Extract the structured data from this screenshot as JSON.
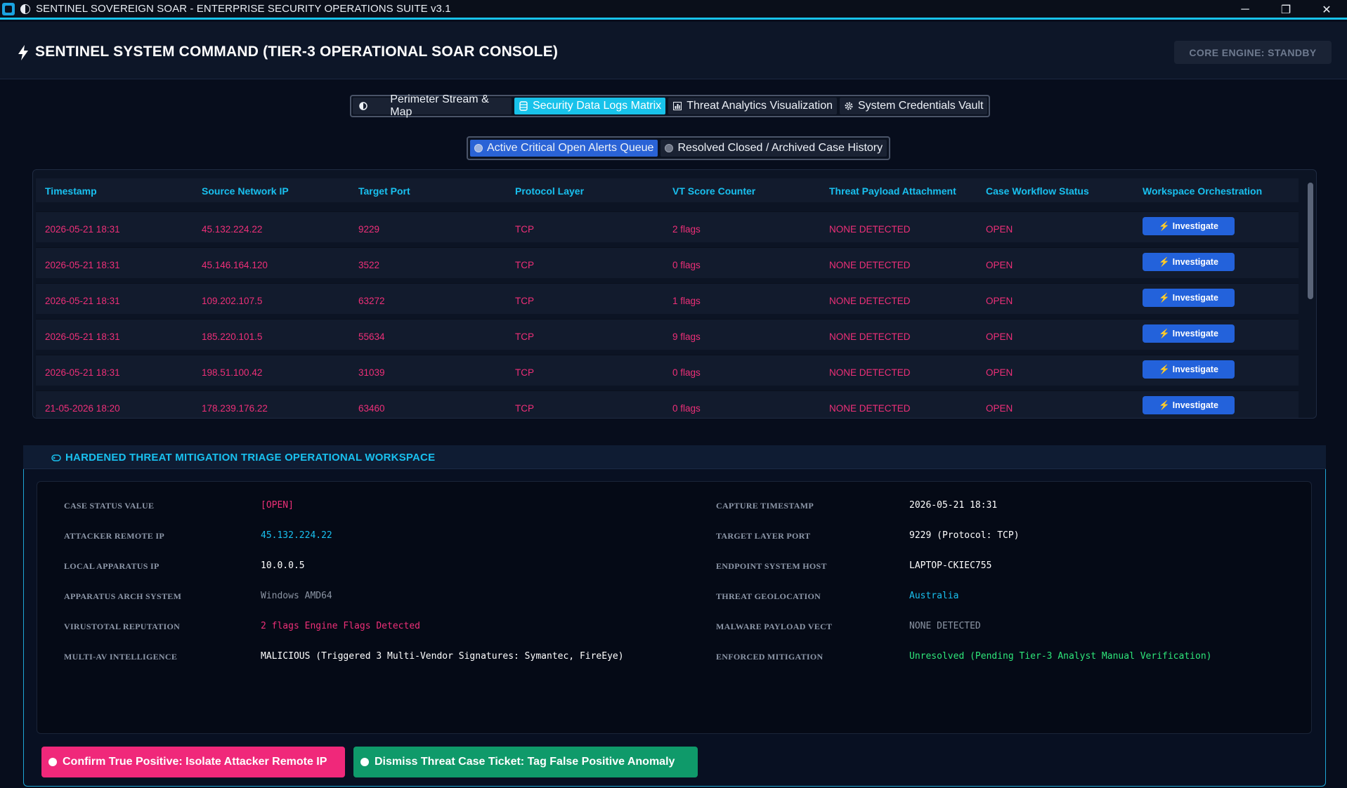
{
  "window": {
    "title": "SENTINEL SOVEREIGN SOAR - ENTERPRISE SECURITY OPERATIONS SUITE v3.1",
    "controls": {
      "minimize": "─",
      "restore": "❐",
      "close": "✕"
    }
  },
  "header": {
    "title": "SENTINEL SYSTEM COMMAND (TIER-3 OPERATIONAL SOAR CONSOLE)",
    "engine_status": "CORE ENGINE: STANDBY"
  },
  "main_tabs": [
    {
      "label": "Perimeter Stream & Map",
      "icon": "half-circle-icon",
      "active": false
    },
    {
      "label": "Security Data Logs Matrix",
      "icon": "database-icon",
      "active": true
    },
    {
      "label": "Threat Analytics Visualization",
      "icon": "bar-chart-icon",
      "active": false
    },
    {
      "label": "System Credentials Vault",
      "icon": "gear-icon",
      "active": false
    }
  ],
  "sub_tabs": [
    {
      "label": "Active Critical Open Alerts Queue",
      "active": true
    },
    {
      "label": "Resolved Closed / Archived Case History",
      "active": false
    }
  ],
  "table": {
    "columns": [
      "Timestamp",
      "Source Network IP",
      "Target Port",
      "Protocol Layer",
      "VT Score Counter",
      "Threat Payload Attachment",
      "Case Workflow Status",
      "Workspace Orchestration"
    ],
    "action_label": "Investigate",
    "rows": [
      {
        "timestamp": "2026-05-21 18:31",
        "ip": "45.132.224.22",
        "port": "9229",
        "protocol": "TCP",
        "vt": "2 flags",
        "payload": "NONE DETECTED",
        "status": "OPEN"
      },
      {
        "timestamp": "2026-05-21 18:31",
        "ip": "45.146.164.120",
        "port": "3522",
        "protocol": "TCP",
        "vt": "0 flags",
        "payload": "NONE DETECTED",
        "status": "OPEN"
      },
      {
        "timestamp": "2026-05-21 18:31",
        "ip": "109.202.107.5",
        "port": "63272",
        "protocol": "TCP",
        "vt": "1 flags",
        "payload": "NONE DETECTED",
        "status": "OPEN"
      },
      {
        "timestamp": "2026-05-21 18:31",
        "ip": "185.220.101.5",
        "port": "55634",
        "protocol": "TCP",
        "vt": "9 flags",
        "payload": "NONE DETECTED",
        "status": "OPEN"
      },
      {
        "timestamp": "2026-05-21 18:31",
        "ip": "198.51.100.42",
        "port": "31039",
        "protocol": "TCP",
        "vt": "0 flags",
        "payload": "NONE DETECTED",
        "status": "OPEN"
      },
      {
        "timestamp": "21-05-2026 18:20",
        "ip": "178.239.176.22",
        "port": "63460",
        "protocol": "TCP",
        "vt": "0 flags",
        "payload": "NONE DETECTED",
        "status": "OPEN"
      }
    ]
  },
  "workspace": {
    "title": "HARDENED THREAT MITIGATION TRIAGE OPERATIONAL WORKSPACE",
    "left_fields": [
      {
        "label": "CASE STATUS VALUE",
        "value": "[OPEN]",
        "color": "#ee2f78"
      },
      {
        "label": "ATTACKER REMOTE IP",
        "value": "45.132.224.22",
        "color": "#19c0ef"
      },
      {
        "label": "LOCAL APPARATUS IP",
        "value": "10.0.0.5",
        "color": "#ffffff"
      },
      {
        "label": "APPARATUS ARCH SYSTEM",
        "value": "Windows AMD64",
        "color": "#8b94a3"
      },
      {
        "label": "VIRUSTOTAL REPUTATION",
        "value": "2 flags Engine Flags Detected",
        "color": "#ee2f78"
      },
      {
        "label": "MULTI-AV INTELLIGENCE",
        "value": "MALICIOUS (Triggered 3 Multi-Vendor Signatures: Symantec, FireEye)",
        "color": "#ffffff"
      }
    ],
    "right_fields": [
      {
        "label": "CAPTURE TIMESTAMP",
        "value": "2026-05-21 18:31",
        "color": "#ffffff"
      },
      {
        "label": "TARGET LAYER PORT",
        "value": "9229 (Protocol: TCP)",
        "color": "#ffffff"
      },
      {
        "label": "ENDPOINT SYSTEM HOST",
        "value": "LAPTOP-CKIEC755",
        "color": "#ffffff"
      },
      {
        "label": "THREAT GEOLOCATION",
        "value": "Australia",
        "color": "#19c0ef"
      },
      {
        "label": "MALWARE PAYLOAD VECT",
        "value": "NONE DETECTED",
        "color": "#8b94a3"
      },
      {
        "label": "ENFORCED MITIGATION",
        "value": "Unresolved (Pending Tier-3 Analyst Manual Verification)",
        "color": "#2ee67a"
      }
    ],
    "confirm_button": "Confirm True Positive: Isolate Attacker Remote IP",
    "dismiss_button": "Dismiss Threat Case Ticket: Tag False Positive Anomaly"
  },
  "colors": {
    "accent": "#19c0ef",
    "alert": "#ee2f78",
    "primary_button": "#2362db",
    "success": "#0f9a6a"
  }
}
